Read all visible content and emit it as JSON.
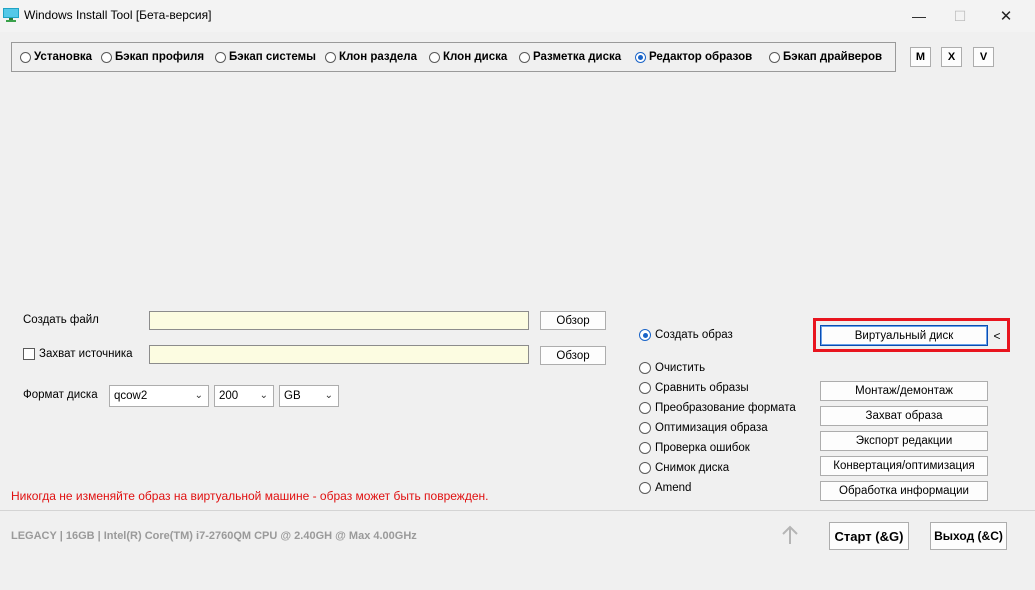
{
  "window": {
    "title": "Windows Install Tool [Бета-версия]",
    "minimize_glyph": "—",
    "maximize_glyph": "☐",
    "close_glyph": "✕"
  },
  "modes": [
    {
      "label": "Установка",
      "selected": false
    },
    {
      "label": "Бэкап профиля",
      "selected": false
    },
    {
      "label": "Бэкап системы",
      "selected": false
    },
    {
      "label": "Клон раздела",
      "selected": false
    },
    {
      "label": "Клон диска",
      "selected": false
    },
    {
      "label": "Разметка диска",
      "selected": false
    },
    {
      "label": "Редактор образов",
      "selected": true
    },
    {
      "label": "Бэкап драйверов",
      "selected": false
    }
  ],
  "corner_buttons": {
    "m": "M",
    "x": "X",
    "v": "V"
  },
  "create_file": {
    "label": "Создать файл",
    "value": "",
    "browse": "Обзор"
  },
  "capture_source": {
    "label": "Захват источника",
    "checked": false,
    "value": "",
    "browse": "Обзор"
  },
  "disk_format": {
    "label": "Формат диска",
    "format": "qcow2",
    "size": "200",
    "unit": "GB"
  },
  "operations": [
    {
      "label": "Создать образ",
      "selected": true
    },
    {
      "label": "Очистить",
      "selected": false
    },
    {
      "label": "Сравнить образы",
      "selected": false
    },
    {
      "label": "Преобразование формата",
      "selected": false
    },
    {
      "label": "Оптимизация образа",
      "selected": false
    },
    {
      "label": "Проверка ошибок",
      "selected": false
    },
    {
      "label": "Снимок диска",
      "selected": false
    },
    {
      "label": "Amend",
      "selected": false
    }
  ],
  "action_buttons": {
    "virtual_disk": "Виртуальный диск",
    "collapse": "<",
    "mount": "Монтаж/демонтаж",
    "capture": "Захват образа",
    "export": "Экспорт редакции",
    "convert": "Конвертация/оптимизация",
    "info": "Обработка информации"
  },
  "warning": "Никогда не изменяйте образ на виртуальной машине - образ может быть поврежден.",
  "status": "LEGACY | 16GB | Intel(R) Core(TM) i7-2760QM CPU @ 2.40GH @ Max 4.00GHz",
  "footer": {
    "start": "Старт (&G)",
    "exit": "Выход (&C)"
  },
  "colors": {
    "highlight": "#e8141e",
    "warning": "#e01010",
    "field_bg": "#fcfce1",
    "radio_on": "#1a64c8"
  },
  "icons": {
    "app": "app-icon",
    "up": "arrow-up-icon"
  }
}
